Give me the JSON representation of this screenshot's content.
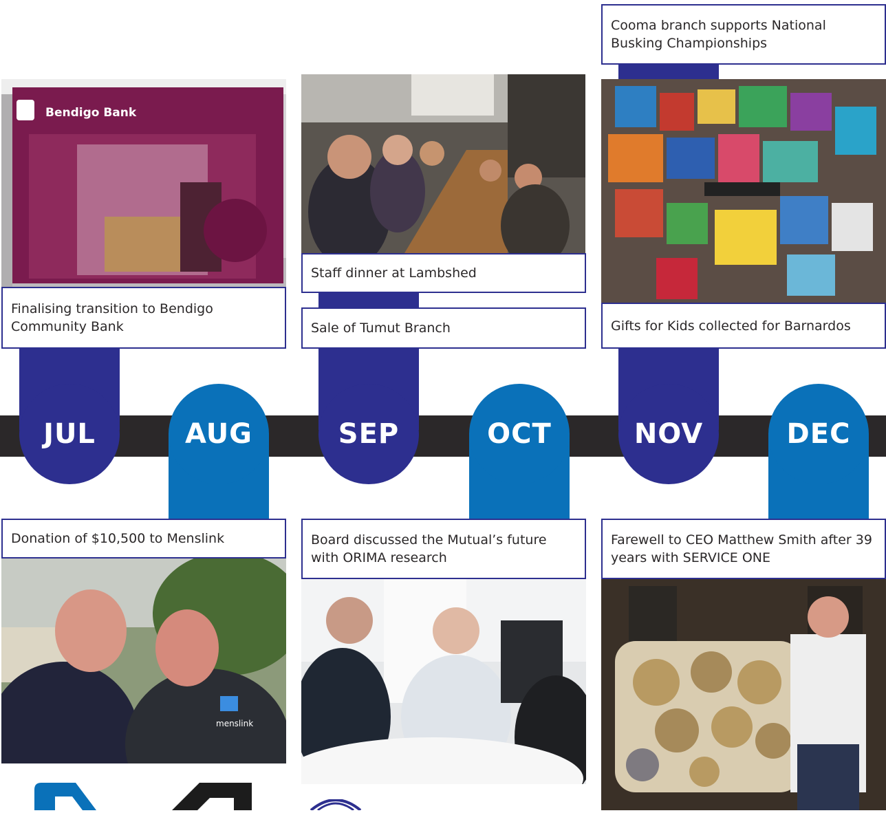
{
  "months": [
    "JUL",
    "AUG",
    "SEP",
    "OCT",
    "NOV",
    "DEC"
  ],
  "captions": {
    "jul_top": "Finalising transition to Bendigo Community Bank",
    "aug_bottom": "Donation of $10,500 to Menslink",
    "sep_photo": "Staff dinner at Lambshed",
    "sep_top": "Sale of Tumut Branch",
    "oct_bottom": "Board discussed the Mutual’s future with ORIMA research",
    "nov_cooma": "Cooma branch supports National Busking Championships",
    "nov_gifts": "Gifts for Kids collected for Barnardos",
    "dec_bottom": "Farewell to CEO Matthew Smith after 39 years with SERVICE ONE"
  },
  "photo_text": {
    "bendigo_sign": "Bendigo Bank",
    "menslink_logo": "menslink"
  },
  "colors": {
    "navy": "#2d2f8f",
    "blue": "#0a71b9",
    "band": "#2b2829"
  }
}
